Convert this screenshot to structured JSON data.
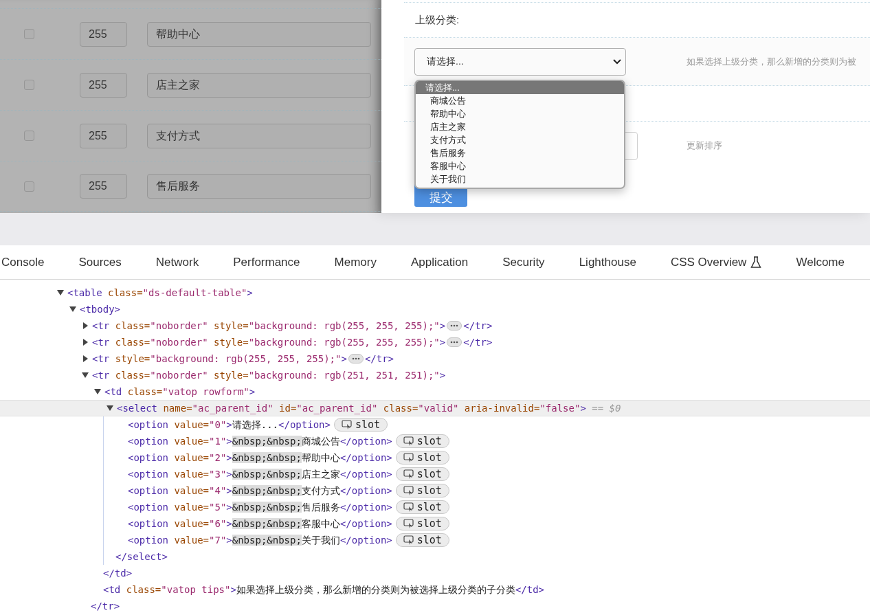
{
  "category_rows": [
    {
      "checked": false,
      "sort": "255",
      "name": "帮助中心"
    },
    {
      "checked": false,
      "sort": "255",
      "name": "店主之家"
    },
    {
      "checked": false,
      "sort": "255",
      "name": "支付方式"
    },
    {
      "checked": false,
      "sort": "255",
      "name": "售后服务"
    }
  ],
  "form": {
    "parent_label": "上级分类:",
    "parent_select": {
      "value": "请选择...",
      "open": true,
      "options": [
        {
          "text": "请选择...",
          "selected": true
        },
        {
          "text": "  商城公告",
          "selected": false
        },
        {
          "text": "  帮助中心",
          "selected": false
        },
        {
          "text": "  店主之家",
          "selected": false
        },
        {
          "text": "  支付方式",
          "selected": false
        },
        {
          "text": "  售后服务",
          "selected": false
        },
        {
          "text": "  客服中心",
          "selected": false
        },
        {
          "text": "  关于我们",
          "selected": false
        }
      ]
    },
    "parent_tip": "如果选择上级分类，那么新增的分类则为被",
    "sort_hint": "更新排序",
    "submit": "提交"
  },
  "devtools": {
    "tabs": [
      {
        "label": "Console"
      },
      {
        "label": "Sources"
      },
      {
        "label": "Network"
      },
      {
        "label": "Performance"
      },
      {
        "label": "Memory"
      },
      {
        "label": "Application"
      },
      {
        "label": "Security"
      },
      {
        "label": "Lighthouse"
      },
      {
        "label": "CSS Overview",
        "experimental": true
      },
      {
        "label": "Welcome"
      }
    ],
    "dom_tree": [
      {
        "expanded": true,
        "selected": false,
        "tokens": [
          {
            "kind": "tag",
            "text": "<table"
          },
          {
            "kind": "attr",
            "text": " class="
          },
          {
            "kind": "value",
            "text": "\"ds-default-table\""
          },
          {
            "kind": "tag",
            "text": ">"
          }
        ],
        "children": [
          {
            "expanded": true,
            "selected": false,
            "tokens": [
              {
                "kind": "tag",
                "text": "<tbody>"
              }
            ],
            "children": [
              {
                "expanded": false,
                "selected": false,
                "tokens": [
                  {
                    "kind": "tag",
                    "text": "<tr"
                  },
                  {
                    "kind": "attr",
                    "text": " class="
                  },
                  {
                    "kind": "value",
                    "text": "\"noborder\""
                  },
                  {
                    "kind": "attr",
                    "text": " style="
                  },
                  {
                    "kind": "value",
                    "text": "\"background: rgb(255, 255, 255);\""
                  },
                  {
                    "kind": "tag",
                    "text": ">"
                  },
                  {
                    "kind": "ellipsis"
                  },
                  {
                    "kind": "tag",
                    "text": "</tr>"
                  }
                ]
              },
              {
                "expanded": false,
                "selected": false,
                "tokens": [
                  {
                    "kind": "tag",
                    "text": "<tr"
                  },
                  {
                    "kind": "attr",
                    "text": " class="
                  },
                  {
                    "kind": "value",
                    "text": "\"noborder\""
                  },
                  {
                    "kind": "attr",
                    "text": " style="
                  },
                  {
                    "kind": "value",
                    "text": "\"background: rgb(255, 255, 255);\""
                  },
                  {
                    "kind": "tag",
                    "text": ">"
                  },
                  {
                    "kind": "ellipsis"
                  },
                  {
                    "kind": "tag",
                    "text": "</tr>"
                  }
                ]
              },
              {
                "expanded": false,
                "selected": false,
                "tokens": [
                  {
                    "kind": "tag",
                    "text": "<tr"
                  },
                  {
                    "kind": "attr",
                    "text": " style="
                  },
                  {
                    "kind": "value",
                    "text": "\"background: rgb(255, 255, 255);\""
                  },
                  {
                    "kind": "tag",
                    "text": ">"
                  },
                  {
                    "kind": "ellipsis"
                  },
                  {
                    "kind": "tag",
                    "text": "</tr>"
                  }
                ]
              },
              {
                "expanded": true,
                "selected": false,
                "tokens": [
                  {
                    "kind": "tag",
                    "text": "<tr"
                  },
                  {
                    "kind": "attr",
                    "text": " class="
                  },
                  {
                    "kind": "value",
                    "text": "\"noborder\""
                  },
                  {
                    "kind": "attr",
                    "text": " style="
                  },
                  {
                    "kind": "value",
                    "text": "\"background: rgb(251, 251, 251);\""
                  },
                  {
                    "kind": "tag",
                    "text": ">"
                  }
                ],
                "close": [
                  {
                    "kind": "tag",
                    "text": "</tr>"
                  }
                ],
                "children": [
                  {
                    "expanded": true,
                    "selected": false,
                    "tokens": [
                      {
                        "kind": "tag",
                        "text": "<td"
                      },
                      {
                        "kind": "attr",
                        "text": " class="
                      },
                      {
                        "kind": "value",
                        "text": "\"vatop rowform\""
                      },
                      {
                        "kind": "tag",
                        "text": ">"
                      }
                    ],
                    "close": [
                      {
                        "kind": "tag",
                        "text": "</td>"
                      }
                    ],
                    "children": [
                      {
                        "expanded": true,
                        "selected": true,
                        "tokens": [
                          {
                            "kind": "tag",
                            "text": "<select"
                          },
                          {
                            "kind": "attr",
                            "text": " name="
                          },
                          {
                            "kind": "value",
                            "text": "\"ac_parent_id\""
                          },
                          {
                            "kind": "attr",
                            "text": " id="
                          },
                          {
                            "kind": "value",
                            "text": "\"ac_parent_id\""
                          },
                          {
                            "kind": "attr",
                            "text": " class="
                          },
                          {
                            "kind": "value",
                            "text": "\"valid\""
                          },
                          {
                            "kind": "attr",
                            "text": " aria-invalid="
                          },
                          {
                            "kind": "value",
                            "text": "\"false\""
                          },
                          {
                            "kind": "tag",
                            "text": ">"
                          },
                          {
                            "kind": "ref",
                            "text": " == $0"
                          }
                        ],
                        "close": [
                          {
                            "kind": "tag",
                            "text": "</select>"
                          }
                        ],
                        "children": [
                          {
                            "selected": false,
                            "tokens": [
                              {
                                "kind": "tag",
                                "text": "<option"
                              },
                              {
                                "kind": "attr",
                                "text": " value="
                              },
                              {
                                "kind": "value",
                                "text": "\"0\""
                              },
                              {
                                "kind": "tag",
                                "text": ">"
                              },
                              {
                                "kind": "text",
                                "text": "请选择..."
                              },
                              {
                                "kind": "tag",
                                "text": "</option>"
                              },
                              {
                                "kind": "slot",
                                "text": "slot"
                              }
                            ]
                          },
                          {
                            "selected": false,
                            "tokens": [
                              {
                                "kind": "tag",
                                "text": "<option"
                              },
                              {
                                "kind": "attr",
                                "text": " value="
                              },
                              {
                                "kind": "value",
                                "text": "\"1\""
                              },
                              {
                                "kind": "tag",
                                "text": ">"
                              },
                              {
                                "kind": "entity",
                                "text": "&nbsp;&nbsp;"
                              },
                              {
                                "kind": "text",
                                "text": "商城公告"
                              },
                              {
                                "kind": "tag",
                                "text": "</option>"
                              },
                              {
                                "kind": "slot",
                                "text": "slot"
                              }
                            ]
                          },
                          {
                            "selected": false,
                            "tokens": [
                              {
                                "kind": "tag",
                                "text": "<option"
                              },
                              {
                                "kind": "attr",
                                "text": " value="
                              },
                              {
                                "kind": "value",
                                "text": "\"2\""
                              },
                              {
                                "kind": "tag",
                                "text": ">"
                              },
                              {
                                "kind": "entity",
                                "text": "&nbsp;&nbsp;"
                              },
                              {
                                "kind": "text",
                                "text": "帮助中心"
                              },
                              {
                                "kind": "tag",
                                "text": "</option>"
                              },
                              {
                                "kind": "slot",
                                "text": "slot"
                              }
                            ]
                          },
                          {
                            "selected": false,
                            "tokens": [
                              {
                                "kind": "tag",
                                "text": "<option"
                              },
                              {
                                "kind": "attr",
                                "text": " value="
                              },
                              {
                                "kind": "value",
                                "text": "\"3\""
                              },
                              {
                                "kind": "tag",
                                "text": ">"
                              },
                              {
                                "kind": "entity",
                                "text": "&nbsp;&nbsp;"
                              },
                              {
                                "kind": "text",
                                "text": "店主之家"
                              },
                              {
                                "kind": "tag",
                                "text": "</option>"
                              },
                              {
                                "kind": "slot",
                                "text": "slot"
                              }
                            ]
                          },
                          {
                            "selected": false,
                            "tokens": [
                              {
                                "kind": "tag",
                                "text": "<option"
                              },
                              {
                                "kind": "attr",
                                "text": " value="
                              },
                              {
                                "kind": "value",
                                "text": "\"4\""
                              },
                              {
                                "kind": "tag",
                                "text": ">"
                              },
                              {
                                "kind": "entity",
                                "text": "&nbsp;&nbsp;"
                              },
                              {
                                "kind": "text",
                                "text": "支付方式"
                              },
                              {
                                "kind": "tag",
                                "text": "</option>"
                              },
                              {
                                "kind": "slot",
                                "text": "slot"
                              }
                            ]
                          },
                          {
                            "selected": false,
                            "tokens": [
                              {
                                "kind": "tag",
                                "text": "<option"
                              },
                              {
                                "kind": "attr",
                                "text": " value="
                              },
                              {
                                "kind": "value",
                                "text": "\"5\""
                              },
                              {
                                "kind": "tag",
                                "text": ">"
                              },
                              {
                                "kind": "entity",
                                "text": "&nbsp;&nbsp;"
                              },
                              {
                                "kind": "text",
                                "text": "售后服务"
                              },
                              {
                                "kind": "tag",
                                "text": "</option>"
                              },
                              {
                                "kind": "slot",
                                "text": "slot"
                              }
                            ]
                          },
                          {
                            "selected": false,
                            "tokens": [
                              {
                                "kind": "tag",
                                "text": "<option"
                              },
                              {
                                "kind": "attr",
                                "text": " value="
                              },
                              {
                                "kind": "value",
                                "text": "\"6\""
                              },
                              {
                                "kind": "tag",
                                "text": ">"
                              },
                              {
                                "kind": "entity",
                                "text": "&nbsp;&nbsp;"
                              },
                              {
                                "kind": "text",
                                "text": "客服中心"
                              },
                              {
                                "kind": "tag",
                                "text": "</option>"
                              },
                              {
                                "kind": "slot",
                                "text": "slot"
                              }
                            ]
                          },
                          {
                            "selected": false,
                            "tokens": [
                              {
                                "kind": "tag",
                                "text": "<option"
                              },
                              {
                                "kind": "attr",
                                "text": " value="
                              },
                              {
                                "kind": "value",
                                "text": "\"7\""
                              },
                              {
                                "kind": "tag",
                                "text": ">"
                              },
                              {
                                "kind": "entity",
                                "text": "&nbsp;&nbsp;"
                              },
                              {
                                "kind": "text",
                                "text": "关于我们"
                              },
                              {
                                "kind": "tag",
                                "text": "</option>"
                              },
                              {
                                "kind": "slot",
                                "text": "slot"
                              }
                            ]
                          }
                        ]
                      }
                    ]
                  },
                  {
                    "selected": false,
                    "tokens": [
                      {
                        "kind": "tag",
                        "text": "<td"
                      },
                      {
                        "kind": "attr",
                        "text": " class="
                      },
                      {
                        "kind": "value",
                        "text": "\"vatop tips\""
                      },
                      {
                        "kind": "tag",
                        "text": ">"
                      },
                      {
                        "kind": "text",
                        "text": "如果选择上级分类，那么新增的分类则为被选择上级分类的子分类"
                      },
                      {
                        "kind": "tag",
                        "text": "</td>"
                      }
                    ]
                  }
                ]
              }
            ]
          }
        ]
      }
    ]
  }
}
